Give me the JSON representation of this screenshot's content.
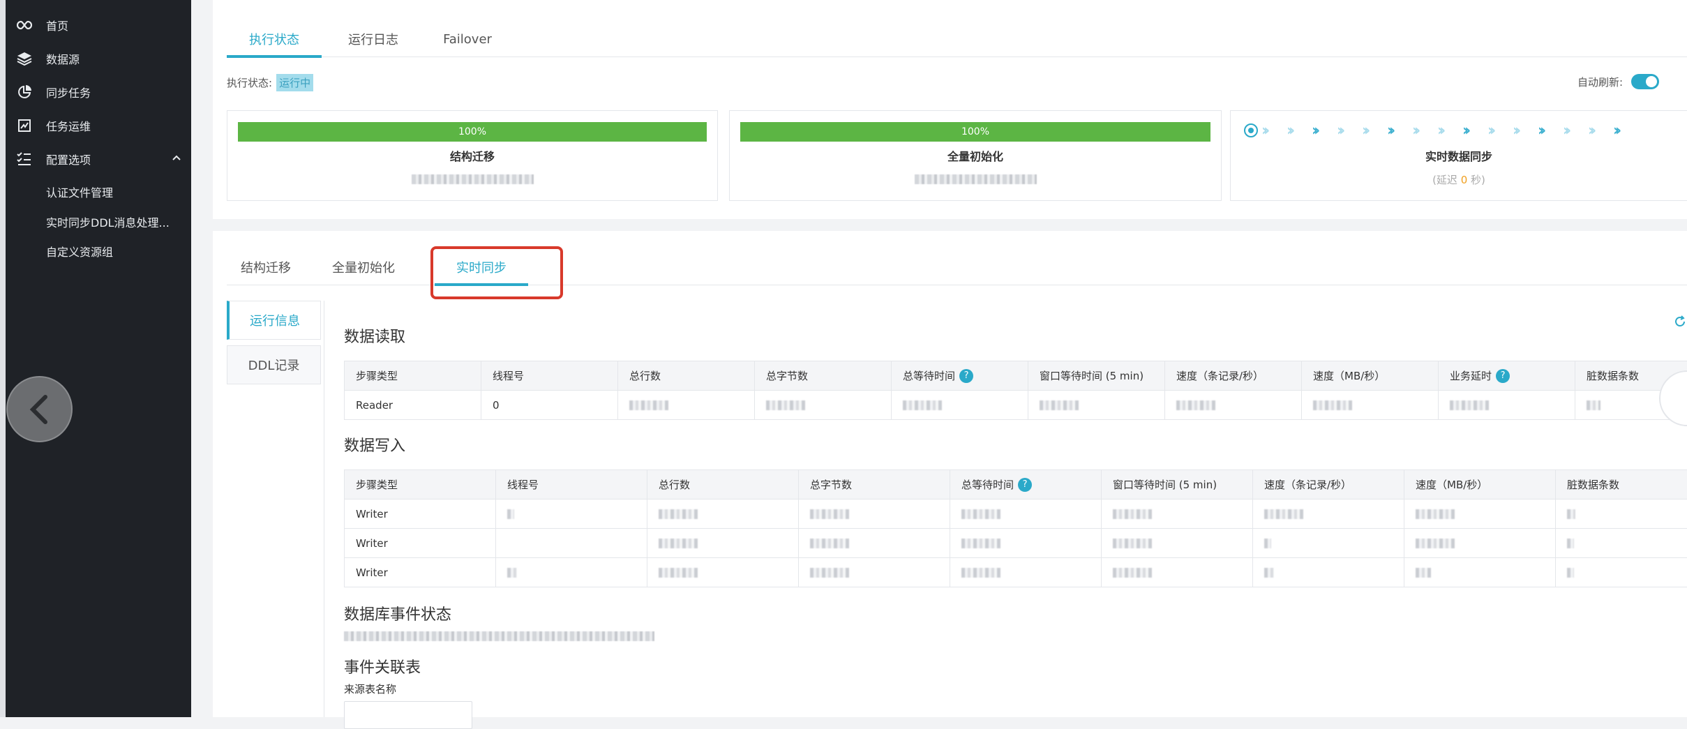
{
  "sidebar": {
    "items": [
      {
        "label": "首页",
        "icon": "infinity-icon"
      },
      {
        "label": "数据源",
        "icon": "layers-icon"
      },
      {
        "label": "同步任务",
        "icon": "pie-chart-icon"
      },
      {
        "label": "任务运维",
        "icon": "monitor-icon"
      },
      {
        "label": "配置选项",
        "icon": "checklist-icon"
      }
    ],
    "sub_items": [
      "认证文件管理",
      "实时同步DDL消息处理...",
      "自定义资源组"
    ]
  },
  "top_tabs": [
    "执行状态",
    "运行日志",
    "Failover"
  ],
  "status": {
    "label": "执行状态:",
    "value": "运行中",
    "auto_refresh_label": "自动刷新:"
  },
  "stages": [
    {
      "progress_label": "100%",
      "progress": 100,
      "name": "结构迁移"
    },
    {
      "progress_label": "100%",
      "progress": 100,
      "name": "全量初始化"
    },
    {
      "name": "实时数据同步",
      "delay_prefix": "(延迟",
      "delay_value": "0",
      "delay_suffix": "秒)"
    }
  ],
  "sub_tabs": [
    "结构迁移",
    "全量初始化",
    "实时同步"
  ],
  "side_tabs": [
    "运行信息",
    "DDL记录"
  ],
  "reader_section": {
    "title": "数据读取",
    "columns": [
      "步骤类型",
      "线程号",
      "总行数",
      "总字节数",
      "总等待时间",
      "窗口等待时间 (5 min)",
      "速度（条记录/秒）",
      "速度（MB/秒）",
      "业务延时",
      "脏数据条数"
    ],
    "rows": [
      {
        "type": "Reader",
        "thread": "0"
      }
    ]
  },
  "writer_section": {
    "title": "数据写入",
    "columns": [
      "步骤类型",
      "线程号",
      "总行数",
      "总字节数",
      "总等待时间",
      "窗口等待时间 (5 min)",
      "速度（条记录/秒）",
      "速度（MB/秒）",
      "脏数据条数"
    ],
    "rows": [
      {
        "type": "Writer"
      },
      {
        "type": "Writer"
      },
      {
        "type": "Writer"
      }
    ]
  },
  "db_event_section": {
    "title": "数据库事件状态"
  },
  "event_relation_section": {
    "title": "事件关联表",
    "source_table_label": "来源表名称"
  },
  "colors": {
    "accent": "#2aa9c9",
    "progress": "#5cb544",
    "sidebar_bg": "#1f2227",
    "highlight": "#d8392b"
  }
}
